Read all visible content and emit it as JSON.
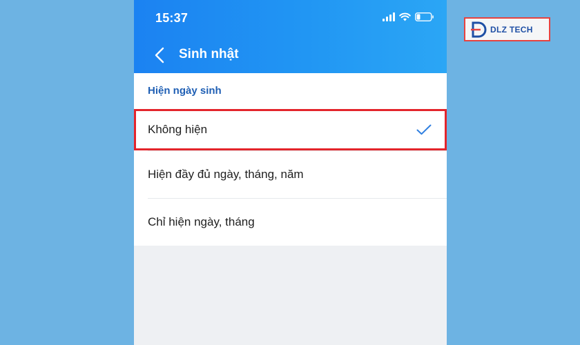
{
  "status_bar": {
    "time": "15:37"
  },
  "nav": {
    "title": "Sinh nhật"
  },
  "section": {
    "label": "Hiện ngày sinh"
  },
  "options": [
    {
      "label": "Không hiện",
      "selected": true
    },
    {
      "label": "Hiện đầy đủ ngày, tháng, năm",
      "selected": false
    },
    {
      "label": "Chỉ hiện ngày, tháng",
      "selected": false
    }
  ],
  "watermark": {
    "brand": "DLZ TECH"
  },
  "colors": {
    "header": "#2196f3",
    "accent": "#1f5fb4",
    "highlight": "#e3242b",
    "backdrop": "#6db3e3"
  },
  "icons": {
    "back": "chevron-left-icon",
    "check": "checkmark-icon",
    "signal": "cellular-signal-icon",
    "wifi": "wifi-icon",
    "battery": "battery-icon"
  }
}
